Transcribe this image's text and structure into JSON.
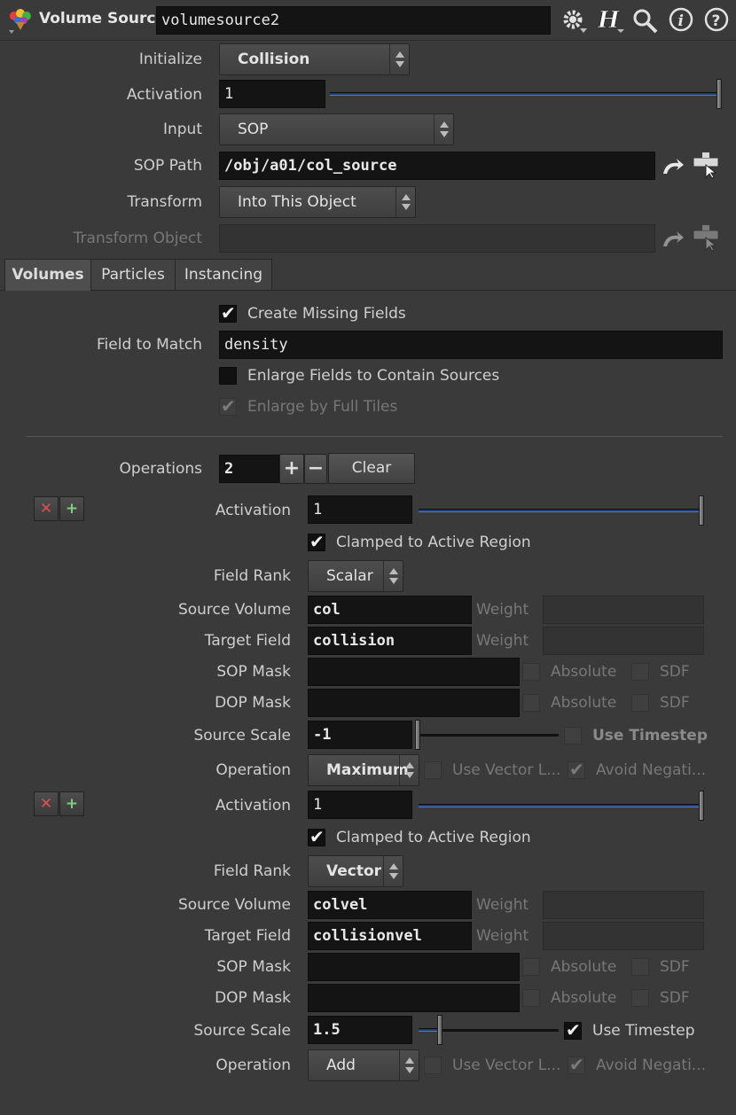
{
  "header": {
    "node_type": "Volume Source",
    "node_name": "volumesource2"
  },
  "top": {
    "initialize_label": "Initialize",
    "initialize_value": "Collision",
    "activation_label": "Activation",
    "activation_value": "1",
    "input_label": "Input",
    "input_value": "SOP",
    "sop_path_label": "SOP Path",
    "sop_path_value": "/obj/a01/col_source",
    "transform_label": "Transform",
    "transform_value": "Into This Object",
    "transform_object_label": "Transform Object",
    "transform_object_value": ""
  },
  "tabs": [
    "Volumes",
    "Particles",
    "Instancing"
  ],
  "volumes": {
    "create_missing_label": "Create Missing Fields",
    "create_missing_checked": true,
    "field_to_match_label": "Field to Match",
    "field_to_match_value": "density",
    "enlarge_label": "Enlarge Fields to Contain Sources",
    "enlarge_checked": false,
    "enlarge_full_label": "Enlarge by Full Tiles",
    "enlarge_full_checked": true,
    "operations_label": "Operations",
    "operations_count": "2",
    "plus": "+",
    "minus": "−",
    "clear_label": "Clear"
  },
  "operations": [
    {
      "activation_label": "Activation",
      "activation_value": "1",
      "clamped_label": "Clamped to Active Region",
      "field_rank_label": "Field Rank",
      "field_rank_value": "Scalar",
      "source_volume_label": "Source Volume",
      "source_volume_value": "col",
      "target_field_label": "Target Field",
      "target_field_value": "collision",
      "weight_label": "Weight",
      "sop_mask_label": "SOP Mask",
      "dop_mask_label": "DOP Mask",
      "absolute_label": "Absolute",
      "sdf_label": "SDF",
      "source_scale_label": "Source Scale",
      "source_scale_value": "-1",
      "source_scale_slider": 0.0,
      "use_timestep_label": "Use Timestep",
      "use_timestep_checked": false,
      "operation_label": "Operation",
      "operation_value": "Maximum",
      "use_vector_label": "Use Vector L...",
      "avoid_neg_label": "Avoid Negati..."
    },
    {
      "activation_label": "Activation",
      "activation_value": "1",
      "clamped_label": "Clamped to Active Region",
      "field_rank_label": "Field Rank",
      "field_rank_value": "Vector",
      "source_volume_label": "Source Volume",
      "source_volume_value": "colvel",
      "target_field_label": "Target Field",
      "target_field_value": "collisionvel",
      "weight_label": "Weight",
      "sop_mask_label": "SOP Mask",
      "dop_mask_label": "DOP Mask",
      "absolute_label": "Absolute",
      "sdf_label": "SDF",
      "source_scale_label": "Source Scale",
      "source_scale_value": "1.5",
      "source_scale_slider": 0.15,
      "use_timestep_label": "Use Timestep",
      "use_timestep_checked": true,
      "operation_label": "Operation",
      "operation_value": "Add",
      "use_vector_label": "Use Vector L...",
      "avoid_neg_label": "Avoid Negati..."
    }
  ],
  "icons": [
    "node-icon",
    "gear-icon",
    "houdini-help-icon",
    "search-icon",
    "info-icon",
    "help-icon",
    "jump-icon",
    "pick-icon"
  ]
}
